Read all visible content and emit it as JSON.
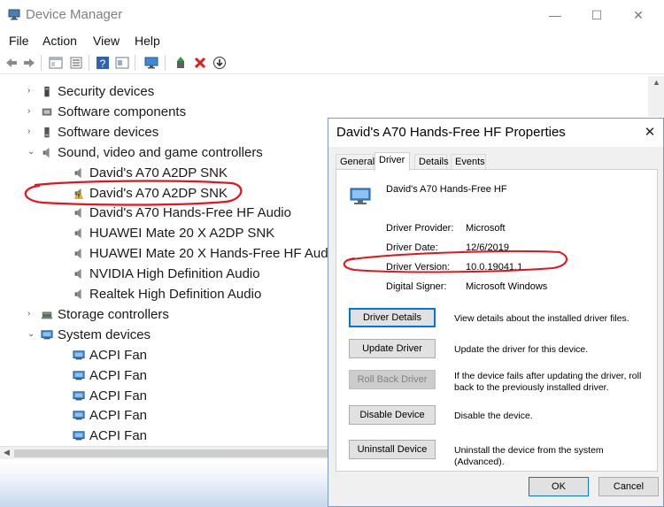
{
  "main_window": {
    "title": "Device Manager",
    "controls": {
      "minimize": "—",
      "maximize": "☐",
      "close": "✕"
    },
    "menu": [
      "File",
      "Action",
      "View",
      "Help"
    ]
  },
  "tree": [
    {
      "label": "Security devices",
      "level": 0,
      "expand": "›",
      "icon": "security-device-icon"
    },
    {
      "label": "Software components",
      "level": 0,
      "expand": "›",
      "icon": "software-component-icon"
    },
    {
      "label": "Software devices",
      "level": 0,
      "expand": "›",
      "icon": "software-device-icon"
    },
    {
      "label": "Sound, video and game controllers",
      "level": 0,
      "expand": "⌄",
      "icon": "speaker-icon"
    },
    {
      "label": "David's A70 A2DP SNK",
      "level": 1,
      "icon": "speaker-icon"
    },
    {
      "label": "David's A70 A2DP SNK",
      "level": 1,
      "icon": "speaker-warning-icon"
    },
    {
      "label": "David's A70 Hands-Free HF Audio",
      "level": 1,
      "icon": "speaker-icon"
    },
    {
      "label": "HUAWEI Mate 20 X A2DP SNK",
      "level": 1,
      "icon": "speaker-icon"
    },
    {
      "label": "HUAWEI Mate 20 X Hands-Free HF Audio",
      "level": 1,
      "icon": "speaker-icon"
    },
    {
      "label": "NVIDIA High Definition Audio",
      "level": 1,
      "icon": "speaker-icon"
    },
    {
      "label": "Realtek High Definition Audio",
      "level": 1,
      "icon": "speaker-icon"
    },
    {
      "label": "Storage controllers",
      "level": 0,
      "expand": "›",
      "icon": "storage-controller-icon"
    },
    {
      "label": "System devices",
      "level": 0,
      "expand": "⌄",
      "icon": "system-device-icon"
    },
    {
      "label": "ACPI Fan",
      "level": 1,
      "icon": "system-device-icon"
    },
    {
      "label": "ACPI Fan",
      "level": 1,
      "icon": "system-device-icon"
    },
    {
      "label": "ACPI Fan",
      "level": 1,
      "icon": "system-device-icon"
    },
    {
      "label": "ACPI Fan",
      "level": 1,
      "icon": "system-device-icon"
    },
    {
      "label": "ACPI Fan",
      "level": 1,
      "icon": "system-device-icon"
    }
  ],
  "dialog": {
    "title": "David's A70 Hands-Free HF Properties",
    "close": "✕",
    "tabs": [
      "General",
      "Driver",
      "Details",
      "Events"
    ],
    "active_tab": "Driver",
    "device_name": "David's A70 Hands-Free HF",
    "fields": [
      {
        "key": "Driver Provider:",
        "value": "Microsoft"
      },
      {
        "key": "Driver Date:",
        "value": "12/6/2019"
      },
      {
        "key": "Driver Version:",
        "value": "10.0.19041.1"
      },
      {
        "key": "Digital Signer:",
        "value": "Microsoft Windows"
      }
    ],
    "actions": [
      {
        "label": "Driver Details",
        "desc": "View details about the installed driver files."
      },
      {
        "label": "Update Driver",
        "desc": "Update the driver for this device."
      },
      {
        "label": "Roll Back Driver",
        "desc": "If the device fails after updating the driver, roll back to the previously installed driver.",
        "disabled": true
      },
      {
        "label": "Disable Device",
        "desc": "Disable the device."
      },
      {
        "label": "Uninstall Device",
        "desc": "Uninstall the device from the system (Advanced)."
      }
    ],
    "ok": "OK",
    "cancel": "Cancel"
  },
  "colors": {
    "annotation": "#e8121c",
    "selection_focus": "#0078d7"
  }
}
